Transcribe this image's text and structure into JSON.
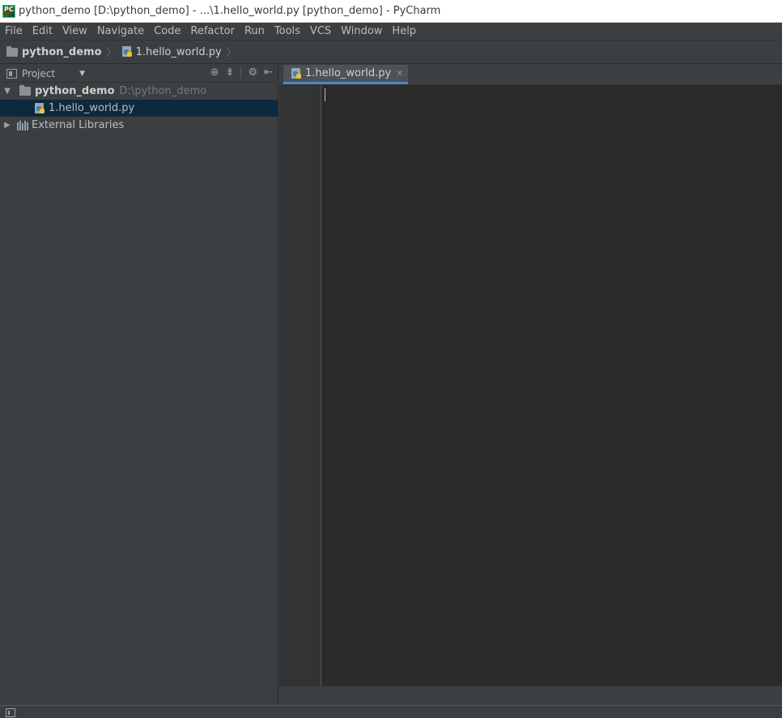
{
  "window": {
    "title": "python_demo [D:\\python_demo] - ...\\1.hello_world.py [python_demo] - PyCharm",
    "icon_text": "PC"
  },
  "menu": [
    "File",
    "Edit",
    "View",
    "Navigate",
    "Code",
    "Refactor",
    "Run",
    "Tools",
    "VCS",
    "Window",
    "Help"
  ],
  "navbar": {
    "project": "python_demo",
    "file": "1.hello_world.py"
  },
  "project_panel": {
    "title": "Project",
    "tree": [
      {
        "label": "python_demo",
        "path": "D:\\python_demo",
        "type": "folder",
        "expanded": true
      },
      {
        "label": "1.hello_world.py",
        "type": "python-file",
        "selected": true
      },
      {
        "label": "External Libraries",
        "type": "library",
        "expanded": false
      }
    ]
  },
  "editor": {
    "tabs": [
      {
        "label": "1.hello_world.py",
        "active": true
      }
    ]
  },
  "icons": {
    "arrow_expanded": "▼",
    "arrow_collapsed": "▶",
    "crumb_separator": "〉",
    "dropdown": "▼",
    "close": "✕",
    "locate": "⊕",
    "collapse": "⇟",
    "gear": "⚙",
    "hide": "⇤"
  }
}
